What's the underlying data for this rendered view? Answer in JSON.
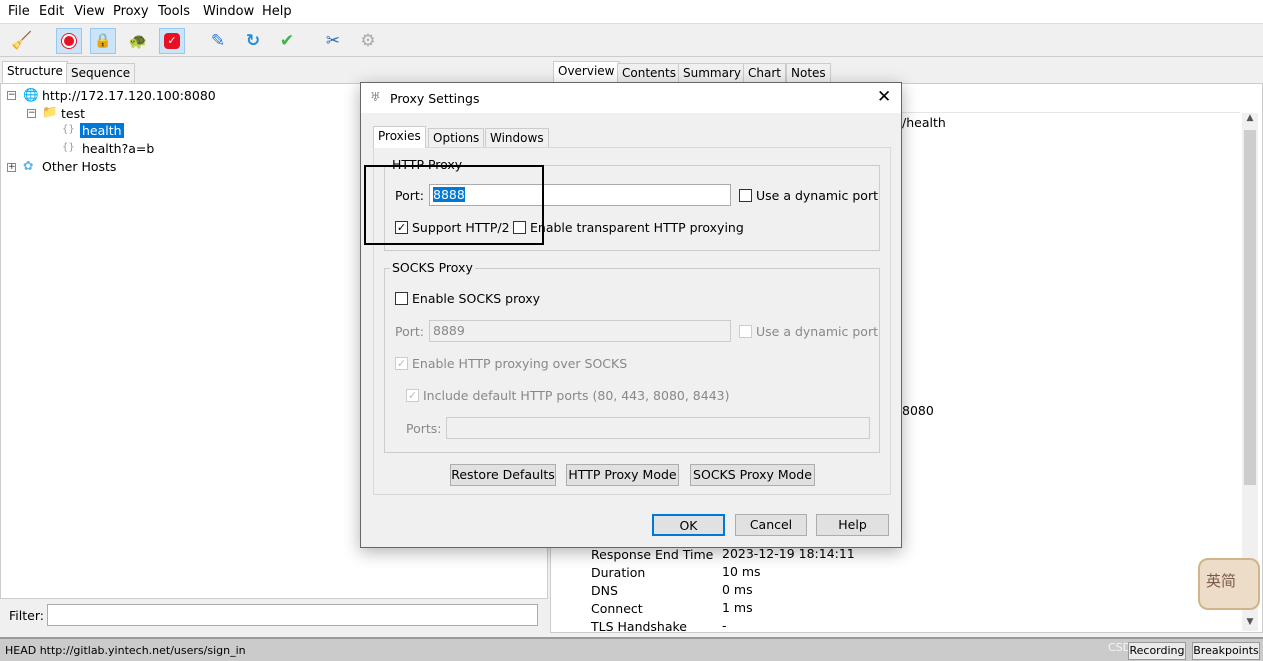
{
  "menu": [
    "File",
    "Edit",
    "View",
    "Proxy",
    "Tools",
    "Window",
    "Help"
  ],
  "toolbar": [
    "broom-icon",
    "record-icon",
    "lock-icon",
    "turtle-icon",
    "stop-icon",
    "pen-icon",
    "refresh-icon",
    "check-icon",
    "tools-icon",
    "gear-icon"
  ],
  "left_tabs": [
    "Structure",
    "Sequence"
  ],
  "tree": {
    "host": "http://172.17.120.100:8080",
    "folder": "test",
    "items": [
      "health",
      "health?a=b"
    ],
    "other": "Other Hosts"
  },
  "filter_label": "Filter:",
  "right_tabs": [
    "Overview",
    "Contents",
    "Summary",
    "Chart",
    "Notes"
  ],
  "overview": {
    "path_fragment": "/health",
    "port_fragment": "8080",
    "rows": [
      {
        "k": "Response End Time",
        "v": "2023-12-19 18:14:11"
      },
      {
        "k": "Duration",
        "v": "10 ms"
      },
      {
        "k": "DNS",
        "v": "0 ms"
      },
      {
        "k": "Connect",
        "v": "1 ms"
      },
      {
        "k": "TLS Handshake",
        "v": "-"
      }
    ]
  },
  "status": {
    "text": "HEAD http://gitlab.yintech.net/users/sign_in",
    "recording": "Recording",
    "breakpoints": "Breakpoints",
    "watermark": "CSDN @jiayth"
  },
  "ime_badge": "英简",
  "dialog": {
    "title": "Proxy Settings",
    "tabs": [
      "Proxies",
      "Options",
      "Windows"
    ],
    "http": {
      "title": "HTTP Proxy",
      "port_label": "Port:",
      "port": "8888",
      "dynamic": "Use a dynamic port",
      "http2": "Support HTTP/2",
      "http2_checked": true,
      "transparent": "Enable transparent HTTP proxying",
      "transparent_checked": false
    },
    "socks": {
      "title": "SOCKS Proxy",
      "enable": "Enable SOCKS proxy",
      "port_label": "Port:",
      "port": "8889",
      "dynamic": "Use a dynamic port",
      "over_socks": "Enable HTTP proxying over SOCKS",
      "include": "Include default HTTP ports (80, 443, 8080, 8443)",
      "ports_label": "Ports:",
      "ports": ""
    },
    "buttons": [
      "Restore Defaults",
      "HTTP Proxy Mode",
      "SOCKS Proxy Mode"
    ],
    "ok": "OK",
    "cancel": "Cancel",
    "help": "Help"
  }
}
